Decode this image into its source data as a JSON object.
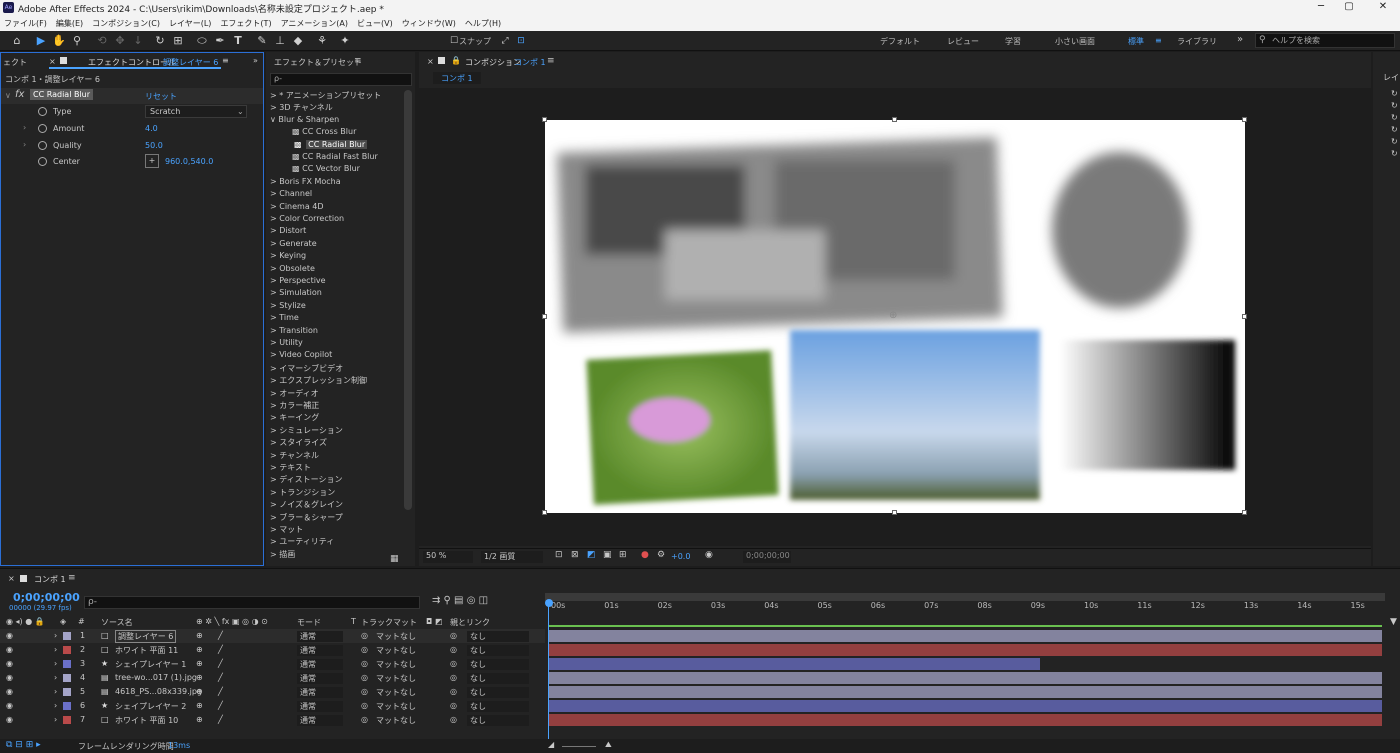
{
  "window": {
    "title": "Adobe After Effects 2024 - C:\\Users\\rikim\\Downloads\\名称未設定プロジェクト.aep *",
    "app_icon": "Ae",
    "controls": [
      "─",
      "▢",
      "✕"
    ]
  },
  "menu": [
    "ファイル(F)",
    "編集(E)",
    "コンポジション(C)",
    "レイヤー(L)",
    "エフェクト(T)",
    "アニメーション(A)",
    "ビュー(V)",
    "ウィンドウ(W)",
    "ヘルプ(H)"
  ],
  "toolbar": {
    "snap_label": "スナップ",
    "workspaces": [
      "デフォルト",
      "レビュー",
      "学習",
      "小さい画面",
      "標準",
      "ライブラリ"
    ],
    "active_workspace": "標準",
    "help_placeholder": "ヘルプを検索"
  },
  "effect_controls": {
    "tab_left": "ェクト",
    "tab_label": "エフェクトコントロール",
    "tab_layer": "調整レイヤー 6",
    "breadcrumb": "コンポ 1・調整レイヤー 6",
    "effect_name": "CC Radial Blur",
    "reset_label": "リセット",
    "props": [
      {
        "name": "Type",
        "value": "Scratch"
      },
      {
        "name": "Amount",
        "value": "4.0"
      },
      {
        "name": "Quality",
        "value": "50.0"
      },
      {
        "name": "Center",
        "value": "960.0,540.0"
      }
    ]
  },
  "effects_presets": {
    "tab_label": "エフェクト＆プリセット",
    "search_placeholder": "ρ-",
    "items": [
      "> * アニメーションプリセット",
      "> 3D チャンネル",
      "∨ Blur & Sharpen",
      "CC Cross Blur",
      "CC Radial Blur",
      "CC Radial Fast Blur",
      "CC Vector Blur",
      "> Boris FX Mocha",
      "> Channel",
      "> Cinema 4D",
      "> Color Correction",
      "> Distort",
      "> Generate",
      "> Keying",
      "> Obsolete",
      "> Perspective",
      "> Simulation",
      "> Stylize",
      "> Time",
      "> Transition",
      "> Utility",
      "> Video Copilot",
      "> イマーシブビデオ",
      "> エクスプレッション制御",
      "> オーディオ",
      "> カラー補正",
      "> キーイング",
      "> シミュレーション",
      "> スタイライズ",
      "> チャンネル",
      "> テキスト",
      "> ディストーション",
      "> トランジション",
      "> ノイズ＆グレイン",
      "> ブラー＆シャープ",
      "> マット",
      "> ユーティリティ",
      "> 描画"
    ],
    "selected": "CC Radial Blur"
  },
  "composition": {
    "tab_label": "コンポジション",
    "comp_name": "コンポ 1",
    "subtab": "コンポ 1",
    "zoom": "50 %",
    "resolution": "1/2 画質",
    "exposure": "+0.0",
    "timecode": "0;00;00;00"
  },
  "right_panel": {
    "label": "レイ"
  },
  "timeline": {
    "tab_label": "コンポ 1",
    "timecode": "0;00;00;00",
    "fps": "00000 (29.97 fps)",
    "search_placeholder": "ρ-",
    "headers": {
      "num": "#",
      "source": "ソース名",
      "mode": "モード",
      "t": "T",
      "trackmatte": "トラックマット",
      "parent": "親とリンク"
    },
    "ruler": [
      "00s",
      "01s",
      "02s",
      "03s",
      "04s",
      "05s",
      "06s",
      "07s",
      "08s",
      "09s",
      "10s",
      "11s",
      "12s",
      "13s",
      "14s",
      "15s"
    ],
    "layers": [
      {
        "num": "1",
        "name": "調整レイヤー 6",
        "color": "#a4a4c8",
        "mode": "通常",
        "matte": "マットなし",
        "parent": "なし",
        "icon": "□",
        "selected": true
      },
      {
        "num": "2",
        "name": "ホワイト 平面 11",
        "color": "#b94a4a",
        "mode": "通常",
        "matte": "マットなし",
        "parent": "なし",
        "icon": "□"
      },
      {
        "num": "3",
        "name": "シェイプレイヤー 1",
        "color": "#6b70c8",
        "mode": "通常",
        "matte": "マットなし",
        "parent": "なし",
        "icon": "★"
      },
      {
        "num": "4",
        "name": "tree-wo...017 (1).jpg",
        "color": "#a4a4c8",
        "mode": "通常",
        "matte": "マットなし",
        "parent": "なし",
        "icon": "▤"
      },
      {
        "num": "5",
        "name": "4618_PS...08x339.jpg",
        "color": "#a4a4c8",
        "mode": "通常",
        "matte": "マットなし",
        "parent": "なし",
        "icon": "▤"
      },
      {
        "num": "6",
        "name": "シェイプレイヤー 2",
        "color": "#6b70c8",
        "mode": "通常",
        "matte": "マットなし",
        "parent": "なし",
        "icon": "★"
      },
      {
        "num": "7",
        "name": "ホワイト 平面 10",
        "color": "#b94a4a",
        "mode": "通常",
        "matte": "マットなし",
        "parent": "なし",
        "icon": "□"
      }
    ],
    "render_time_label": "フレームレンダリング時間",
    "render_time": "13ms"
  }
}
